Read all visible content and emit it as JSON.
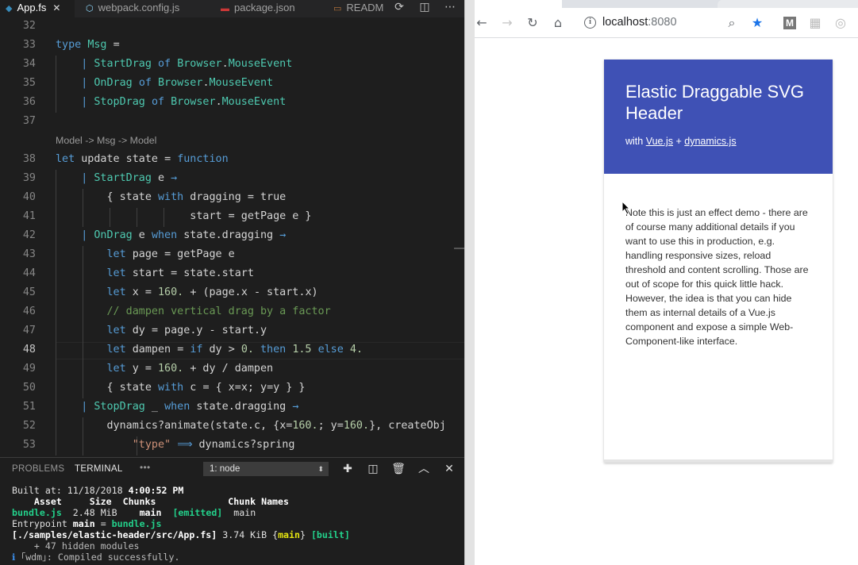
{
  "editor": {
    "tabs": [
      {
        "label": "App.fs",
        "icon": "fsharp-icon",
        "active": true
      },
      {
        "label": "webpack.config.js",
        "icon": "webpack-icon",
        "active": false
      },
      {
        "label": "package.json",
        "icon": "npm-icon",
        "active": false
      },
      {
        "label": "READM",
        "icon": "markdown-icon",
        "active": false
      }
    ],
    "lines": [
      {
        "n": "32",
        "text": ""
      },
      {
        "n": "33",
        "text": "type Msg ="
      },
      {
        "n": "34",
        "text": "    | StartDrag of Browser.MouseEvent"
      },
      {
        "n": "35",
        "text": "    | OnDrag of Browser.MouseEvent"
      },
      {
        "n": "36",
        "text": "    | StopDrag of Browser.MouseEvent"
      },
      {
        "n": "37",
        "text": ""
      },
      {
        "n": "",
        "text": "Model -> Msg -> Model"
      },
      {
        "n": "38",
        "text": "let update state = function"
      },
      {
        "n": "39",
        "text": "    | StartDrag e →"
      },
      {
        "n": "40",
        "text": "        { state with dragging = true"
      },
      {
        "n": "41",
        "text": "                     start = getPage e }"
      },
      {
        "n": "42",
        "text": "    | OnDrag e when state.dragging →"
      },
      {
        "n": "43",
        "text": "        let page = getPage e"
      },
      {
        "n": "44",
        "text": "        let start = state.start"
      },
      {
        "n": "45",
        "text": "        let x = 160. + (page.x - start.x)"
      },
      {
        "n": "46",
        "text": "        // dampen vertical drag by a factor"
      },
      {
        "n": "47",
        "text": "        let dy = page.y - start.y"
      },
      {
        "n": "48",
        "text": "        let dampen = if dy > 0. then 1.5 else 4."
      },
      {
        "n": "49",
        "text": "        let y = 160. + dy / dampen"
      },
      {
        "n": "50",
        "text": "        { state with c = { x=x; y=y } }"
      },
      {
        "n": "51",
        "text": "    | StopDrag _ when state.dragging →"
      },
      {
        "n": "52",
        "text": "        dynamics?animate(state.c, {x=160.; y=160.}, createObj"
      },
      {
        "n": "53",
        "text": "            \"type\" ⟹ dynamics?spring"
      }
    ],
    "current_line": "48"
  },
  "panel": {
    "tabs": [
      "PROBLEMS",
      "TERMINAL"
    ],
    "more": "•••",
    "terminal_select": "1: node",
    "terminal": {
      "built_at_label": "Built at: 11/18/2018",
      "built_at_time": "4:00:52 PM",
      "header": "    Asset     Size  Chunks             Chunk Names",
      "row_asset": "bundle.js",
      "row_size": "2.48 MiB",
      "row_chunk": "main",
      "row_flag": "[emitted]",
      "row_name": "main",
      "entry_prefix": "Entrypoint",
      "entry_main": "main",
      "entry_eq": "=",
      "entry_file": "bundle.js",
      "module_path": "[./samples/elastic-header/src/App.fs]",
      "module_size": "3.74 KiB",
      "module_chunk": "main",
      "module_flag": "[built]",
      "hidden": "    + 47 hidden modules",
      "compiled": "｢wdm｣: Compiled successfully."
    }
  },
  "browser": {
    "url_host": "localhost",
    "url_port": ":8080",
    "page": {
      "title": "Elastic Draggable SVG Header",
      "with": "with",
      "link1": "Vue.js",
      "plus": "+",
      "link2": "dynamics.js",
      "note": "Note this is just an effect demo - there are of course many additional details if you want to use this in production, e.g. handling responsive sizes, reload threshold and content scrolling. Those are out of scope for this quick little hack. However, the idea is that you can hide them as internal details of a Vue.js component and expose a simple Web-Component-like interface."
    },
    "header_color": "#3f51b5"
  }
}
